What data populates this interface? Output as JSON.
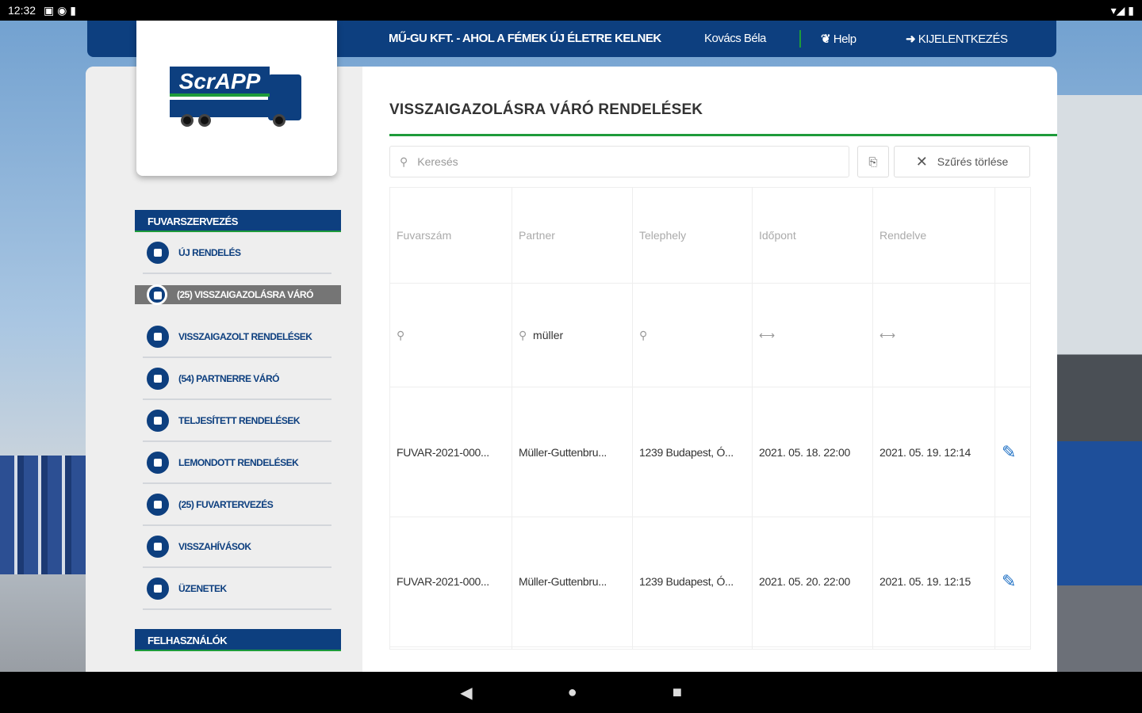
{
  "status_bar": {
    "time": "12:32"
  },
  "header": {
    "company": "MŰ-GU KFT. - AHOL A FÉMEK ÚJ ÉLETRE KELNEK",
    "user": "Kovács Béla",
    "help": "Help",
    "logout": "KIJELENTKEZÉS"
  },
  "logo": {
    "text": "ScrAPP"
  },
  "sidebar": {
    "section1": "FUVARSZERVEZÉS",
    "items": [
      {
        "label": "ÚJ RENDELÉS",
        "icon": "cart-icon"
      },
      {
        "label": "(25) VISSZAIGAZOLÁSRA VÁRÓ",
        "icon": "edit-icon",
        "active": true
      },
      {
        "label": "VISSZAIGAZOLT RENDELÉSEK",
        "icon": "truck-icon"
      },
      {
        "label": "(54) PARTNERRE VÁRÓ",
        "icon": "clock-icon"
      },
      {
        "label": "TELJESÍTETT RENDELÉSEK",
        "icon": "list-icon"
      },
      {
        "label": "LEMONDOTT RENDELÉSEK",
        "icon": "cancel-icon"
      },
      {
        "label": "(25) FUVARTERVEZÉS",
        "icon": "calendar-icon"
      },
      {
        "label": "VISSZAHÍVÁSOK",
        "icon": "callback-icon"
      },
      {
        "label": "ÜZENETEK",
        "icon": "message-icon"
      }
    ],
    "section2": "FELHASZNÁLÓK"
  },
  "main": {
    "title": "VISSZAIGAZOLÁSRA VÁRÓ RENDELÉSEK",
    "search_placeholder": "Keresés",
    "clear_filter": "Szűrés törlése",
    "columns": [
      "Fuvarszám",
      "Partner",
      "Telephely",
      "Időpont",
      "Rendelve"
    ],
    "filters": {
      "partner": "müller"
    },
    "rows": [
      [
        "FUVAR-2021-000...",
        "Müller-Guttenbru...",
        "1239 Budapest, Ó...",
        "2021. 05. 18. 22:00",
        "2021. 05. 19. 12:14"
      ],
      [
        "FUVAR-2021-000...",
        "Müller-Guttenbru...",
        "1239 Budapest, Ó...",
        "2021. 05. 20. 22:00",
        "2021. 05. 19. 12:15"
      ]
    ]
  },
  "colors": {
    "brand": "#0d3f7f",
    "accent": "#1e9b3a"
  }
}
